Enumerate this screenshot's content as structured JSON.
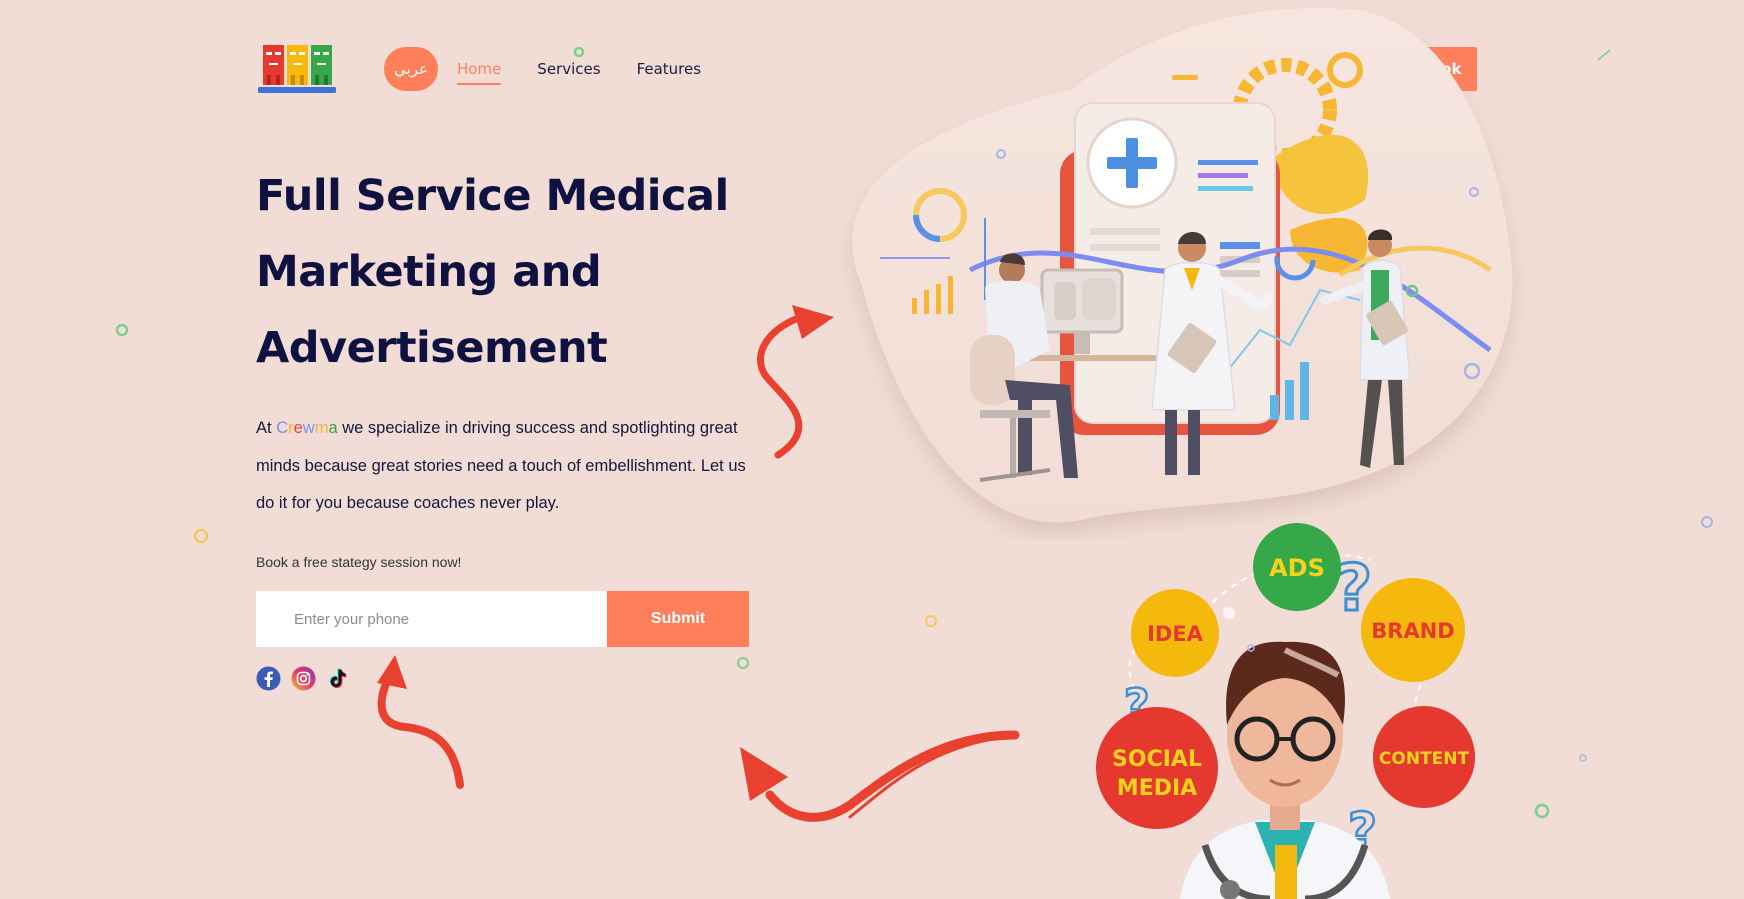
{
  "colors": {
    "background": "#f1ddd5",
    "accent": "#ff7f5a",
    "heading": "#0f1140",
    "arrow": "#e9412f"
  },
  "header": {
    "lang_label": "عربي",
    "nav": [
      {
        "label": "Home",
        "active": true
      },
      {
        "label": "Services",
        "active": false
      },
      {
        "label": "Features",
        "active": false
      }
    ],
    "book_label": "Book"
  },
  "hero": {
    "title_lines": [
      "Full Service Medical",
      "Marketing and",
      "Advertisement"
    ],
    "text_prefix": "At ",
    "brand_letters": [
      "C",
      "r",
      "e",
      "w",
      "m",
      "a"
    ],
    "text_suffix": " we specialize in driving success and spotlighting great minds because great stories need a touch of embellishment. Let us do it for you because coaches never play."
  },
  "cta": {
    "label": "Book a free stategy session now!",
    "phone_placeholder": "Enter your phone",
    "submit_label": "Submit"
  },
  "socials": [
    "facebook-icon",
    "instagram-icon",
    "tiktok-icon"
  ],
  "illustration": {
    "bubbles": [
      {
        "text": "ADS",
        "color": "#36a84a"
      },
      {
        "text": "IDEA",
        "color": "#f5b80c"
      },
      {
        "text": "BRAND",
        "color": "#f5b80c"
      },
      {
        "text": "SOCIAL",
        "text2": "MEDIA",
        "color": "#e5392f"
      },
      {
        "text": "CONTENT",
        "color": "#e5392f"
      }
    ]
  }
}
